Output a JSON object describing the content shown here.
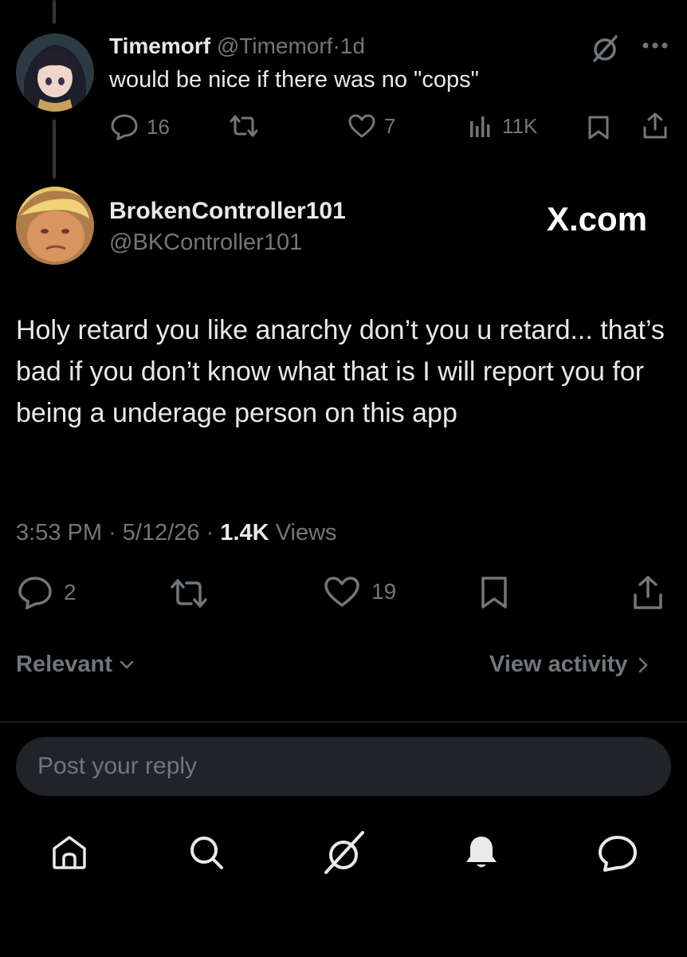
{
  "parent_tweet": {
    "display_name": "Timemorf",
    "handle": "@Timemorf",
    "separator": "·",
    "time": "1d",
    "text": "would be nice if there was no \"cops\"",
    "replies": "16",
    "likes": "7",
    "views": "11K"
  },
  "main_tweet": {
    "display_name": "BrokenController101",
    "handle": "@BKController101",
    "watermark": "X.com",
    "text": "Holy retard you like anarchy don’t you u retard... that’s bad if you don’t know what that is I will report you for being a underage person on this app",
    "time": "3:53 PM",
    "date": "5/12/26",
    "sep1": "·",
    "sep2": "·",
    "views_count": "1.4K",
    "views_label": "Views",
    "replies": "2",
    "likes": "19"
  },
  "filters": {
    "sort_label": "Relevant",
    "activity_label": "View activity"
  },
  "reply": {
    "placeholder": "Post your reply"
  },
  "icons": {
    "avatar_parent": "anime-avatar",
    "avatar_main": "photo-avatar",
    "grok": "grok-icon",
    "more": "more-icon",
    "reply": "reply-icon",
    "retweet": "retweet-icon",
    "like": "like-icon",
    "views": "views-icon",
    "bookmark": "bookmark-icon",
    "share": "share-icon",
    "chevron_down": "chevron-down-icon",
    "chevron_right": "chevron-right-icon",
    "home": "home-icon",
    "search": "search-icon",
    "notifications": "bell-icon",
    "messages": "message-icon"
  },
  "colors": {
    "background": "#000000",
    "text": "#e7e9ea",
    "muted": "#71767b",
    "reply_box": "#202327",
    "divider": "#2f3336"
  }
}
